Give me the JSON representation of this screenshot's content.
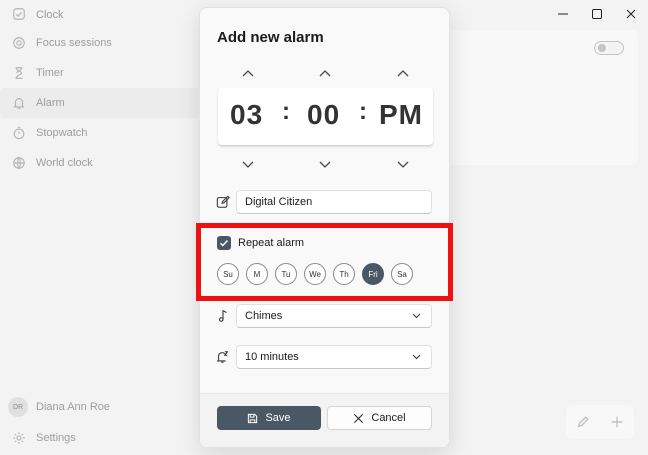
{
  "app": {
    "title": "Clock"
  },
  "nav": {
    "items": [
      {
        "label": "Focus sessions",
        "icon": "focus-icon"
      },
      {
        "label": "Timer",
        "icon": "hourglass-icon"
      },
      {
        "label": "Alarm",
        "icon": "bell-icon",
        "active": true
      },
      {
        "label": "Stopwatch",
        "icon": "stopwatch-icon"
      },
      {
        "label": "World clock",
        "icon": "globe-icon"
      }
    ]
  },
  "user": {
    "initials": "DR",
    "name": "Diana Ann Roe"
  },
  "settings": {
    "label": "Settings"
  },
  "dialog": {
    "title": "Add new alarm",
    "time": {
      "hour": "03",
      "minute": "00",
      "period": "PM",
      "separator": ":"
    },
    "name_value": "Digital Citizen",
    "repeat": {
      "label": "Repeat alarm",
      "checked": true,
      "days": [
        "Su",
        "M",
        "Tu",
        "We",
        "Th",
        "Fri",
        "Sa"
      ],
      "selected": [
        "Fri"
      ]
    },
    "sound": "Chimes",
    "snooze": "10 minutes",
    "save_label": "Save",
    "cancel_label": "Cancel"
  },
  "colors": {
    "accent": "#4a5866",
    "highlight": "#ee1111"
  }
}
